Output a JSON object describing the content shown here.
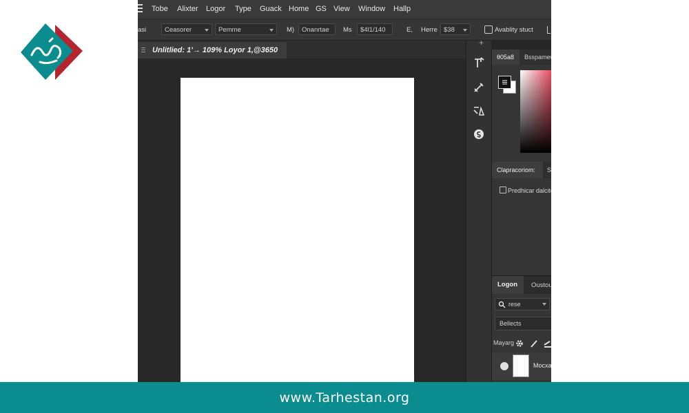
{
  "brand": {
    "logo_icon": "tarhestan-logo-icon",
    "colors": {
      "teal": "#0b8c8f",
      "red": "#b3252f"
    }
  },
  "menubar": {
    "items": [
      "Tobe",
      "Alixter",
      "Logor",
      "Type",
      "Guack",
      "Home",
      "GS",
      "View",
      "Window",
      "Hallp"
    ]
  },
  "options_bar": {
    "lead_label": "asi",
    "select_1": "Ceasorer",
    "select_2": "Pemme",
    "label_m": "M)",
    "field_1": "Onanrtae",
    "label_ms": "Ms",
    "field_2": "$4l1/140",
    "label_e": "E,",
    "label_here": "Herre",
    "field_3": "$38",
    "label_ability": "Avablity stuct"
  },
  "document_tab": {
    "title": "Unlitlied: 1'→ 109% Loyor 1,@3650"
  },
  "right_panel": {
    "color_tabs": [
      "θ05a8",
      "Bsspamew"
    ],
    "section2_tabs": [
      "Clapracoriom:",
      "S"
    ],
    "checkbox_label": "Predhicar dalcitons",
    "layers_tabs": [
      "Logon",
      "Oustou"
    ],
    "filter_placeholder": "rese",
    "blend_mode": "Bellects",
    "lock_label": "Mayarg",
    "layer_name": "Mocxas"
  },
  "footer": {
    "url": "www.Tarhestan.org"
  }
}
